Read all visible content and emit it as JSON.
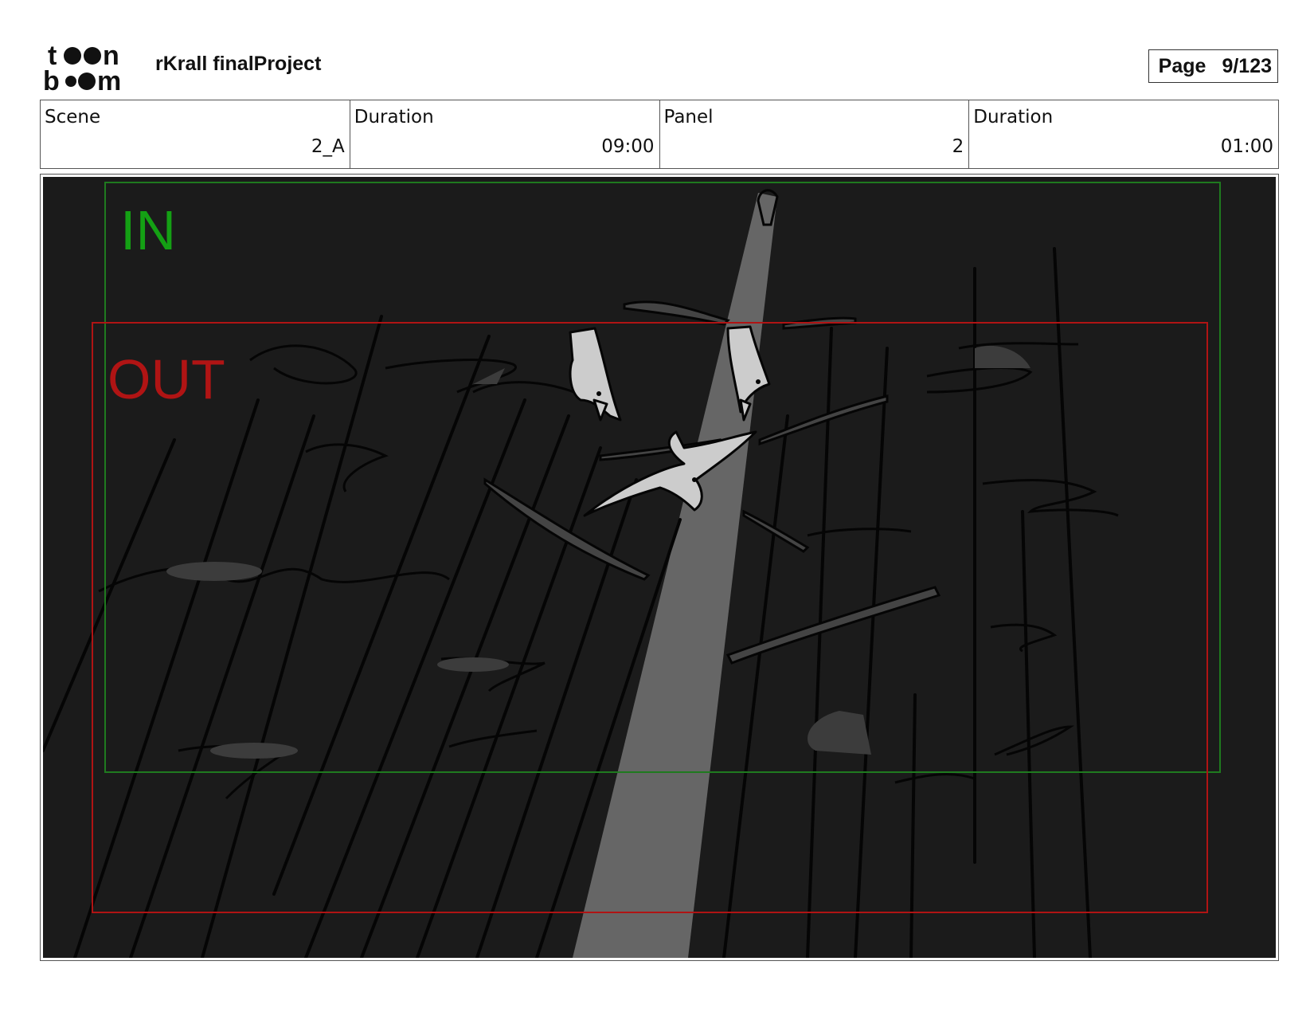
{
  "header": {
    "logo_text": "toon boom",
    "project_title": "rKrall finalProject",
    "page_label": "Page",
    "page_number": "9/123"
  },
  "info": {
    "scene_label": "Scene",
    "scene_value": "2_A",
    "scene_duration_label": "Duration",
    "scene_duration_value": "09:00",
    "panel_label": "Panel",
    "panel_value": "2",
    "panel_duration_label": "Duration",
    "panel_duration_value": "01:00"
  },
  "panel": {
    "in_label": "IN",
    "out_label": "OUT",
    "colors": {
      "background": "#1b1b1b",
      "light_beam": "#666666",
      "birds": "#cccccc",
      "in_frame": "#1f7a1f",
      "out_frame": "#b01414"
    }
  }
}
